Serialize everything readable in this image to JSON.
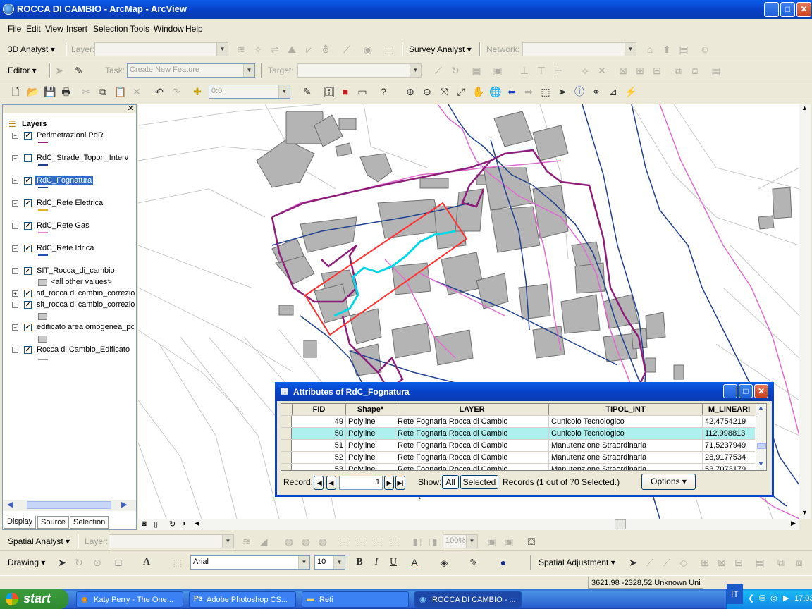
{
  "window": {
    "title": "ROCCA DI CAMBIO - ArcMap - ArcView",
    "min": "_",
    "max": "□",
    "close": "✕"
  },
  "menu": [
    "File",
    "Edit",
    "View",
    "Insert",
    "Selection",
    "Tools",
    "Window",
    "Help"
  ],
  "toolbar1": {
    "analyst": "3D Analyst ▾",
    "layer_label": "Layer:",
    "survey": "Survey Analyst ▾",
    "network_label": "Network:"
  },
  "toolbar2": {
    "editor": "Editor ▾",
    "task_label": "Task:",
    "task_value": "Create New Feature",
    "target_label": "Target:"
  },
  "toolbar3": {
    "scale": "0:0"
  },
  "toc": {
    "root": "Layers",
    "layers": [
      {
        "name": "Perimetrazioni PdR",
        "checked": "✓",
        "color": "#9b1f83",
        "expand": "−"
      },
      {
        "name": "RdC_Strade_Topon_Interv",
        "checked": "",
        "color": "#1f3f8f",
        "expand": "−"
      },
      {
        "name": "RdC_Fognatura",
        "checked": "✓",
        "color": "#1f3f8f",
        "expand": "−"
      },
      {
        "name": "RdC_Rete Elettrica",
        "checked": "✓",
        "color": "#e6b020",
        "expand": "−"
      },
      {
        "name": "RdC_Rete Gas",
        "checked": "✓",
        "color": "#e888d0",
        "expand": "−"
      },
      {
        "name": "RdC_Rete Idrica",
        "checked": "✓",
        "color": "#2050c0",
        "expand": "−"
      },
      {
        "name": "SIT_Rocca_di_cambio",
        "checked": "✓",
        "color": "",
        "expand": "−"
      },
      {
        "name": "sit_rocca di cambio_correzio",
        "checked": "✓",
        "color": "",
        "expand": "+"
      },
      {
        "name": "sit_rocca di cambio_correzio",
        "checked": "✓",
        "color": "",
        "expand": "−"
      },
      {
        "name": "edificato area omogenea_pc",
        "checked": "✓",
        "color": "",
        "expand": "−"
      },
      {
        "name": "Rocca di Cambio_Edificato",
        "checked": "✓",
        "color": "",
        "expand": "−"
      }
    ],
    "other_values": "<all other values>",
    "tabs": [
      "Display",
      "Source",
      "Selection"
    ]
  },
  "attributes": {
    "title": "Attributes of RdC_Fognatura",
    "columns": [
      "FID",
      "Shape*",
      "LAYER",
      "TIPOL_INT",
      "M_LINEARI"
    ],
    "rows": [
      [
        "49",
        "Polyline",
        "Rete Fognaria Rocca di Cambio",
        "Cunicolo Tecnologico",
        "42,4754219"
      ],
      [
        "50",
        "Polyline",
        "Rete Fognaria Rocca di Cambio",
        "Cunicolo Tecnologico",
        "112,998813"
      ],
      [
        "51",
        "Polyline",
        "Rete Fognaria Rocca di Cambio",
        "Manutenzione Straordinaria",
        "71,5237949"
      ],
      [
        "52",
        "Polyline",
        "Rete Fognaria Rocca di Cambio",
        "Manutenzione Straordinaria",
        "28,9177534"
      ],
      [
        "53",
        "Polyline",
        "Rete Fognaria Rocca di Cambio",
        "Manutenzione Straordinaria",
        "53,7073179"
      ]
    ],
    "record_label": "Record:",
    "record_value": "1",
    "show_label": "Show:",
    "all": "All",
    "selected": "Selected",
    "records_text": "Records  (1 out of 70 Selected.)",
    "options": "Options ▾"
  },
  "bottom_toolbars": {
    "spatial": "Spatial Analyst ▾",
    "layer_label": "Layer:",
    "zoom": "100%",
    "drawing": "Drawing ▾",
    "font": "Arial",
    "size": "10",
    "bold": "B",
    "italic": "I",
    "underline": "U",
    "adjust": "Spatial Adjustment ▾"
  },
  "status": {
    "coords": "3621,98  -2328,52 Unknown Uni"
  },
  "taskbar": {
    "start": "start",
    "items": [
      "Katy Perry - The One...",
      "Adobe Photoshop CS...",
      "Reti",
      "ROCCA DI CAMBIO - ..."
    ],
    "lang": "IT",
    "time": "17.03"
  }
}
